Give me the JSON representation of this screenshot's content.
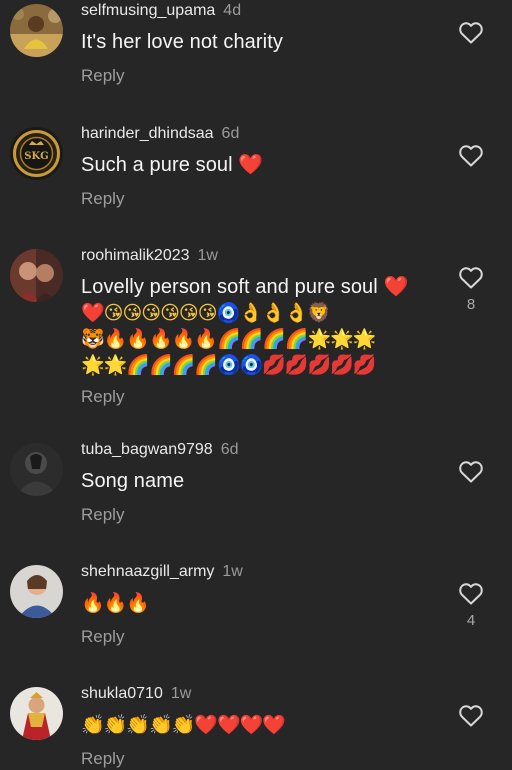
{
  "comments": [
    {
      "username": "selfmusing_upama",
      "time": "4d",
      "text": "It's her love not charity",
      "emoji_lines": [],
      "reply_label": "Reply",
      "likes": ""
    },
    {
      "username": "harinder_dhindsaa",
      "time": "6d",
      "text": "Such a pure soul ❤️",
      "emoji_lines": [],
      "reply_label": "Reply",
      "likes": ""
    },
    {
      "username": "roohimalik2023",
      "time": "1w",
      "text": "Lovelly person soft  and pure soul ❤️",
      "emoji_lines": [
        "❤️😘😘😘😘😘😘🧿👌👌👌🦁",
        "🐯🔥🔥🔥🔥🔥🌈🌈🌈🌈🌟🌟🌟",
        "🌟🌟🌈🌈🌈🌈🧿🧿💋💋💋💋💋"
      ],
      "reply_label": "Reply",
      "likes": "8"
    },
    {
      "username": "tuba_bagwan9798",
      "time": "6d",
      "text": "Song name",
      "emoji_lines": [],
      "reply_label": "Reply",
      "likes": ""
    },
    {
      "username": "shehnaazgill_army",
      "time": "1w",
      "text": "🔥🔥🔥",
      "emoji_lines": [],
      "reply_label": "Reply",
      "likes": "4"
    },
    {
      "username": "shukla0710",
      "time": "1w",
      "text": "👏👏👏👏👏❤️❤️❤️❤️",
      "emoji_lines": [],
      "reply_label": "Reply",
      "likes": ""
    }
  ],
  "avatar_badge_text": "SKG",
  "colors": {
    "background": "#262626",
    "text": "#f2f2f2",
    "muted": "#9a9a9a",
    "heart_outline": "#d8d8d8",
    "emoji_heart": "#e0242c"
  },
  "icons": {
    "like": "heart-outline-icon"
  }
}
